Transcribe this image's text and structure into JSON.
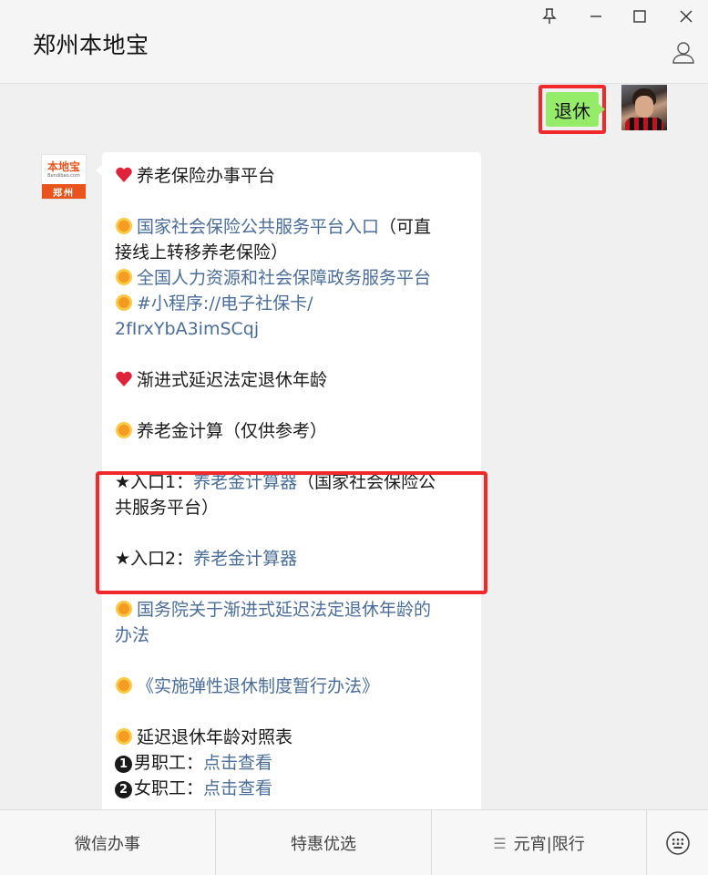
{
  "window": {
    "title": "郑州本地宝",
    "controls": [
      "pin-icon",
      "minimize-icon",
      "maximize-icon",
      "close-icon"
    ],
    "profile_icon": "person-icon"
  },
  "chat": {
    "my_message": "退休",
    "bot_logo": {
      "cn": "本地宝",
      "en": "Bendibao.com",
      "city": "郑州"
    },
    "bot_message": {
      "section1_title": "养老保险办事平台",
      "link_social_insurance_a": "国家社会保险公共服务平台入口",
      "link_social_insurance_b": "（可直",
      "link_social_insurance_c": "接线上转移养老保险）",
      "link_hr_platform": "全国人力资源和社会保障政务服务平台",
      "link_mini_program_a": "#小程序://电子社保卡/",
      "link_mini_program_b": "2fIrxYbA3imSCqj",
      "section2_title": "渐进式延迟法定退休年龄",
      "pension_calc_title": "养老金计算（仅供参考）",
      "entry1_prefix": "★入口1：",
      "entry1_link": "养老金计算器",
      "entry1_suffix_a": "（国家社会保险公",
      "entry1_suffix_b": "共服务平台）",
      "entry2_prefix": "★入口2：",
      "entry2_link": "养老金计算器",
      "link_state_council_a": "国务院关于渐进式延迟法定退休年龄的",
      "link_state_council_b": "办法",
      "link_flexible_retirement": "《实施弹性退休制度暂行办法》",
      "table_title": "延迟退休年龄对照表",
      "male_label": "男职工：",
      "male_link": "点击查看",
      "female_label": "女职工：",
      "female_link": "点击查看",
      "male_num": "1",
      "female_num": "2"
    }
  },
  "menu": {
    "items": [
      "微信办事",
      "特惠优选",
      "元宵|限行"
    ],
    "menu3_icon": "menu-lines-icon",
    "keyboard_icon": "keyboard-icon"
  },
  "colors": {
    "link": "#4a6d99",
    "my_bubble": "#95ec69",
    "highlight": "#f02a2a",
    "brand_orange": "#e8541c"
  }
}
